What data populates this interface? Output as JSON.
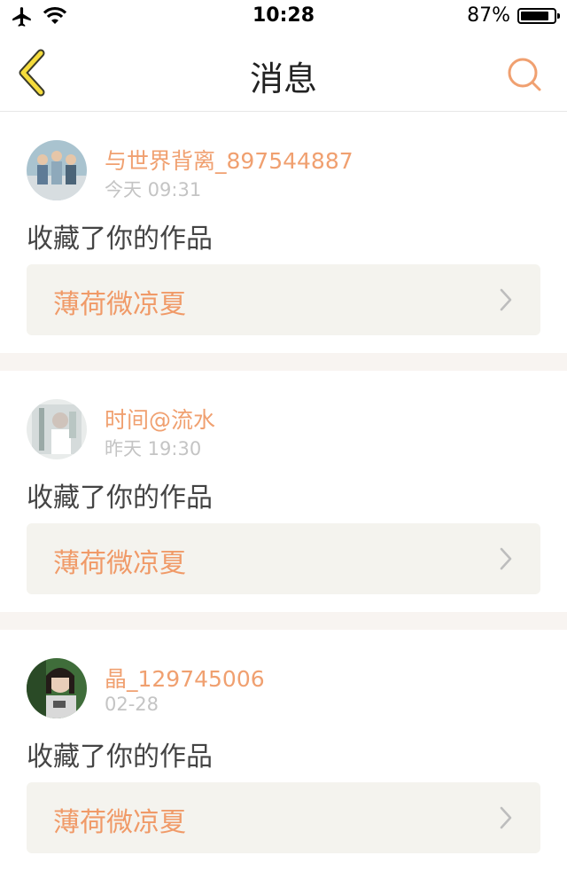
{
  "status_bar": {
    "time": "10:28",
    "battery_percent": "87%",
    "battery_level": 0.87,
    "icons": [
      "airplane-icon",
      "wifi-icon",
      "battery-icon"
    ]
  },
  "nav": {
    "title": "消息",
    "back_icon": "chevron-left-icon",
    "search_icon": "search-icon"
  },
  "colors": {
    "accent": "#f0a070",
    "back_arrow": "#f5dc3c",
    "card_link_bg": "#f4f3ee",
    "separator": "#f8f4f1"
  },
  "messages": [
    {
      "username": "与世界背离_897544887",
      "time": "今天 09:31",
      "action": "收藏了你的作品",
      "work_title": "薄荷微凉夏"
    },
    {
      "username": "时间@流水",
      "time": "昨天 19:30",
      "action": "收藏了你的作品",
      "work_title": "薄荷微凉夏"
    },
    {
      "username": "晶_129745006",
      "time": "02-28",
      "action": "收藏了你的作品",
      "work_title": "薄荷微凉夏"
    }
  ]
}
